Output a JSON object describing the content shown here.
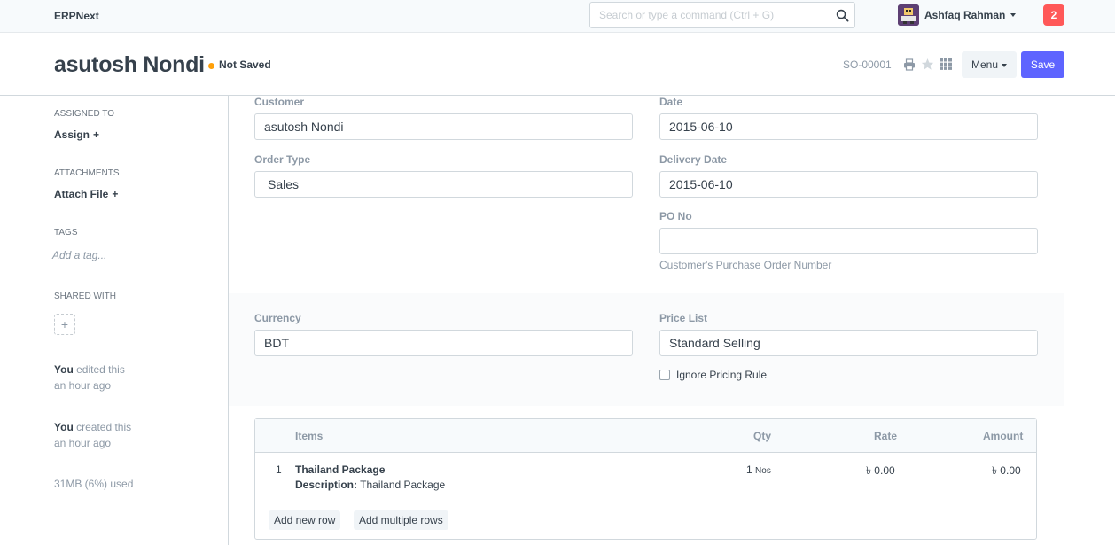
{
  "navbar": {
    "brand": "ERPNext",
    "search_placeholder": "Search or type a command (Ctrl + G)",
    "search_icon": "search-icon",
    "user_name": "Ashfaq Rahman",
    "notification_count": "2",
    "notification_color": "#ff5858"
  },
  "header": {
    "title": "asutosh Nondi",
    "status": "Not Saved",
    "status_color": "#ffa00a",
    "doc_name": "SO-00001",
    "menu_label": "Menu",
    "save_label": "Save",
    "save_color": "#5e64ff",
    "icons": [
      "print-icon",
      "star-icon",
      "grid-icon"
    ]
  },
  "sidebar": {
    "assigned_to_label": "ASSIGNED TO",
    "assign_action": "Assign",
    "attachments_label": "ATTACHMENTS",
    "attach_action": "Attach File",
    "tags_label": "TAGS",
    "tag_placeholder": "Add a tag...",
    "shared_with_label": "SHARED WITH",
    "share_plus": "+",
    "activity": [
      {
        "who": "You",
        "what": " edited this",
        "when": "an hour ago"
      },
      {
        "who": "You",
        "what": " created this",
        "when": "an hour ago"
      }
    ],
    "usage": "31MB (6%) used"
  },
  "form": {
    "customer_label": "Customer",
    "customer_value": "asutosh Nondi",
    "date_label": "Date",
    "date_value": "2015-06-10",
    "order_type_label": "Order Type",
    "order_type_value": "Sales",
    "delivery_date_label": "Delivery Date",
    "delivery_date_value": "2015-06-10",
    "po_no_label": "PO No",
    "po_no_value": "",
    "po_no_help": "Customer's Purchase Order Number",
    "currency_label": "Currency",
    "currency_value": "BDT",
    "price_list_label": "Price List",
    "price_list_value": "Standard Selling",
    "ignore_pricing_rule_label": "Ignore Pricing Rule",
    "ignore_pricing_rule_checked": false
  },
  "items": {
    "columns": [
      "Items",
      "Qty",
      "Rate",
      "Amount"
    ],
    "rows": [
      {
        "idx": "1",
        "item": "Thailand Package",
        "description_label": "Description:",
        "description": "Thailand Package",
        "qty": "1",
        "uom": "Nos",
        "rate": "৳ 0.00",
        "amount": "৳ 0.00"
      }
    ],
    "add_row_label": "Add new row",
    "add_multiple_label": "Add multiple rows"
  }
}
